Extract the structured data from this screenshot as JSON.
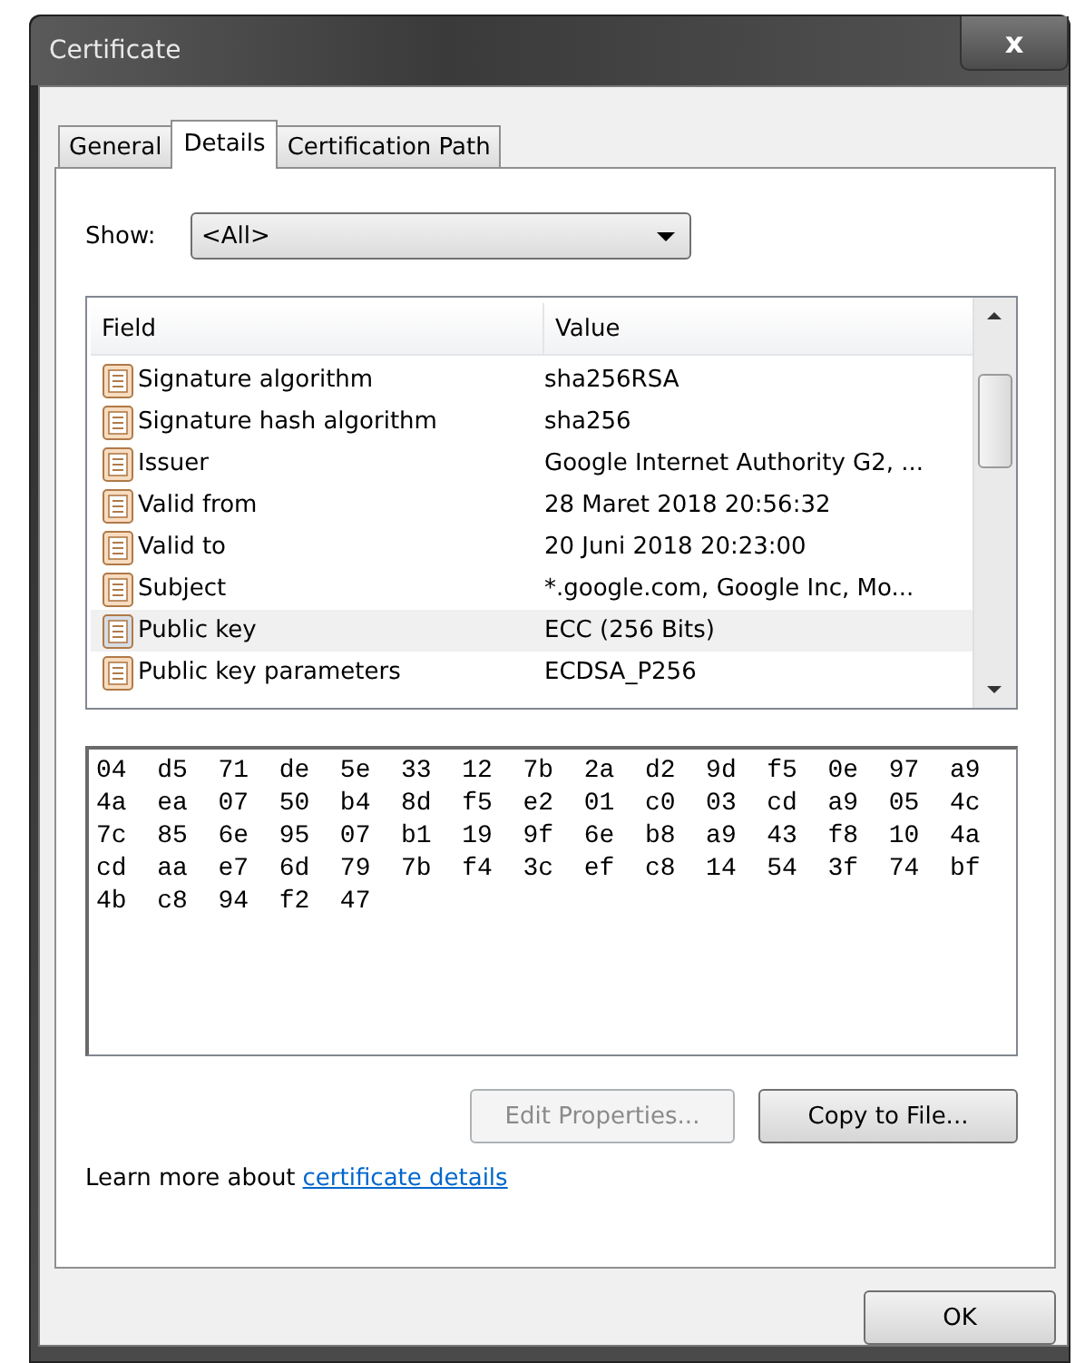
{
  "window": {
    "title": "Certificate",
    "close": "x"
  },
  "tabs": [
    {
      "label": "General",
      "selected": false
    },
    {
      "label": "Details",
      "selected": true
    },
    {
      "label": "Certification Path",
      "selected": false
    }
  ],
  "show": {
    "label": "Show:",
    "value": "<All>"
  },
  "table": {
    "columns": [
      "Field",
      "Value"
    ],
    "rows": [
      {
        "field": "Signature algorithm",
        "value": "sha256RSA",
        "selected": false
      },
      {
        "field": "Signature hash algorithm",
        "value": "sha256",
        "selected": false
      },
      {
        "field": "Issuer",
        "value": "Google Internet Authority G2, ...",
        "selected": false
      },
      {
        "field": "Valid from",
        "value": "28 Maret 2018 20:56:32",
        "selected": false
      },
      {
        "field": "Valid to",
        "value": "20 Juni 2018 20:23:00",
        "selected": false
      },
      {
        "field": "Subject",
        "value": "*.google.com, Google Inc, Mo...",
        "selected": false
      },
      {
        "field": "Public key",
        "value": "ECC (256 Bits)",
        "selected": true
      },
      {
        "field": "Public key parameters",
        "value": "ECDSA_P256",
        "selected": false
      }
    ]
  },
  "detail_lines": [
    "04  d5  71  de  5e  33  12  7b  2a  d2  9d  f5  0e  97  a9",
    "4a  ea  07  50  b4  8d  f5  e2  01  c0  03  cd  a9  05  4c",
    "7c  85  6e  95  07  b1  19  9f  6e  b8  a9  43  f8  10  4a",
    "cd  aa  e7  6d  79  7b  f4  3c  ef  c8  14  54  3f  74  bf",
    "4b  c8  94  f2  47"
  ],
  "buttons": [
    {
      "label": "Edit Properties...",
      "disabled": true
    },
    {
      "label": "Copy to File...",
      "disabled": false
    }
  ],
  "learn_more": {
    "text": "Learn more about",
    "link": "certificate details"
  },
  "ok": "OK"
}
